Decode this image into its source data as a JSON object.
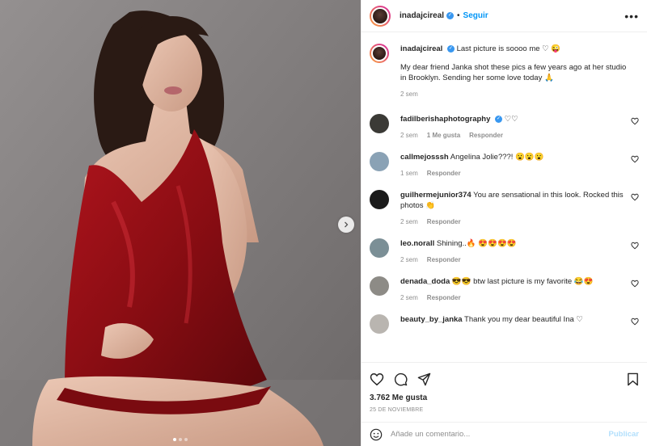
{
  "post": {
    "author": "inadajcireal",
    "follow_label": "Seguir",
    "more_label": "•••",
    "separator": "•",
    "verified_mark": "✓"
  },
  "caption": {
    "username": "inadajcireal",
    "line1": "Last picture is soooo me ♡ 😜",
    "line2": "My dear friend Janka shot these pics a few years ago at her studio in Brooklyn. Sending her some love today 🙏",
    "time": "2 sem"
  },
  "comments": [
    {
      "username": "fadilberishaphotography",
      "verified": true,
      "text": "♡♡",
      "time": "2 sem",
      "likes": "1 Me gusta",
      "reply": "Responder",
      "avatar_color": "#3b3a36"
    },
    {
      "username": "callmejosssh",
      "verified": false,
      "text": "Angelina Jolie???! 😮😮😮",
      "time": "1 sem",
      "likes": "",
      "reply": "Responder",
      "avatar_color": "#8aa2b5"
    },
    {
      "username": "guilhermejunior374",
      "verified": false,
      "text": "You are sensational in this look. Rocked this photos 👏",
      "time": "2 sem",
      "likes": "",
      "reply": "Responder",
      "avatar_color": "#1b1b1b"
    },
    {
      "username": "leo.norall",
      "verified": false,
      "text": "Shining..🔥 😍😍😍😍",
      "time": "2 sem",
      "likes": "",
      "reply": "Responder",
      "avatar_color": "#7b8f96"
    },
    {
      "username": "denada_doda",
      "verified": false,
      "text": "😎😎 btw last picture is my favorite 😂😍",
      "time": "2 sem",
      "likes": "",
      "reply": "Responder",
      "avatar_color": "#8d8b86"
    },
    {
      "username": "beauty_by_janka",
      "verified": false,
      "text": "Thank you my dear beautiful Ina ♡",
      "time": "",
      "likes": "",
      "reply": "",
      "avatar_color": "#b9b5b0"
    }
  ],
  "stats": {
    "likes": "3.762 Me gusta",
    "date": "25 DE NOVIEMBRE"
  },
  "composer": {
    "placeholder": "Añade un comentario...",
    "publish_label": "Publicar"
  },
  "carousel": {
    "slides": 3,
    "active_index": 0
  },
  "icons": [
    "heart-icon",
    "comment-icon",
    "share-icon",
    "bookmark-icon",
    "emoji-icon",
    "chevron-right-icon"
  ],
  "colors": {
    "accent": "#0095f6",
    "dress": "#8e0f14",
    "background": "#7a7676"
  }
}
